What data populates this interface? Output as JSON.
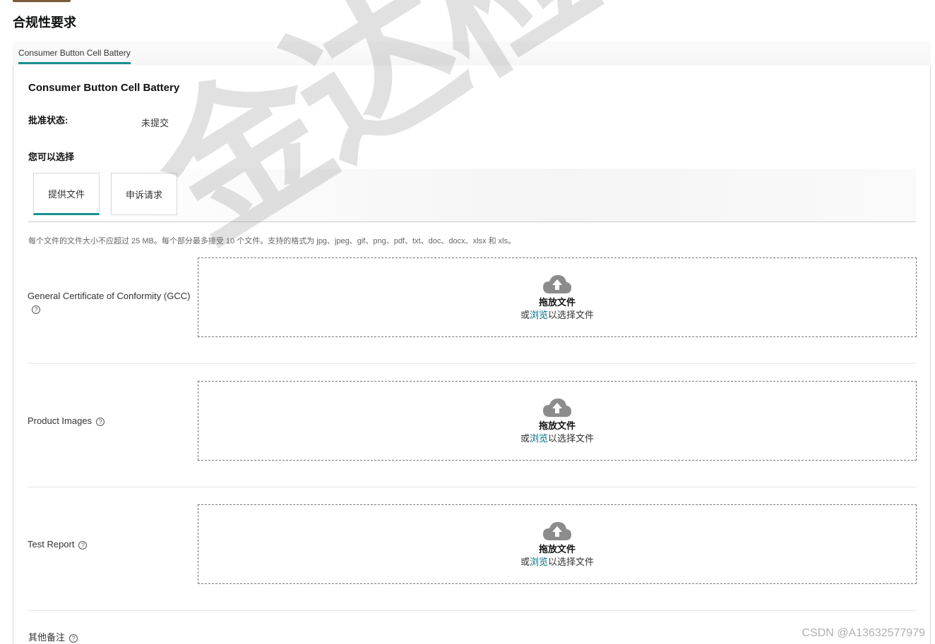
{
  "page": {
    "title": "合规性要求",
    "top_tab": "Consumer Button Cell Battery"
  },
  "panel": {
    "category_title": "Consumer Button Cell Battery",
    "status_label": "批准状态:",
    "status_value": "未提交",
    "choose_label": "您可以选择",
    "tabs": [
      {
        "label": "提供文件",
        "active": true
      },
      {
        "label": "申诉请求",
        "active": false
      }
    ],
    "file_hint": "每个文件的文件大小不应超过 25 MB。每个部分最多接受 10 个文件。支持的格式为 jpg、jpeg、gif、png、pdf、txt、doc、docx、xlsx 和 xls。"
  },
  "uploads": [
    {
      "label": "General Certificate of Conformity (GCC)",
      "drop_title": "拖放文件",
      "drop_prefix": "或",
      "browse": "浏览",
      "drop_suffix": "以选择文件"
    },
    {
      "label": "Product Images",
      "drop_title": "拖放文件",
      "drop_prefix": "或",
      "browse": "浏览",
      "drop_suffix": "以选择文件"
    },
    {
      "label": "Test Report",
      "drop_title": "拖放文件",
      "drop_prefix": "或",
      "browse": "浏览",
      "drop_suffix": "以选择文件"
    }
  ],
  "notes_label": "其他备注",
  "help_glyph": "?",
  "icons": {
    "help": "help-circle-icon",
    "upload": "cloud-upload-icon"
  },
  "colors": {
    "accent": "#1a8f8f",
    "link": "#007185"
  },
  "watermark": "金达检测",
  "credit": "CSDN @A13632577979"
}
